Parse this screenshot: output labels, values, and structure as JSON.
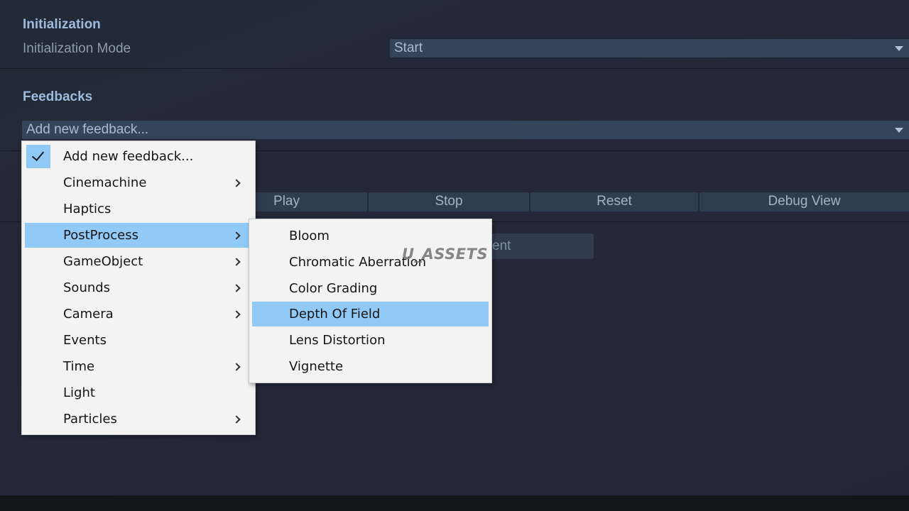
{
  "initialization": {
    "title": "Initialization",
    "mode_label": "Initialization Mode",
    "mode_value": "Start"
  },
  "feedbacks": {
    "title": "Feedbacks",
    "add_dropdown_value": "Add new feedback..."
  },
  "toolbar": {
    "play_label": "Play",
    "stop_label": "Stop",
    "reset_label": "Reset",
    "debug_label": "Debug View"
  },
  "obscured_button_text": "ent",
  "menu": {
    "items": [
      {
        "label": "Add new feedback...",
        "checked": true,
        "submenu": false
      },
      {
        "label": "Cinemachine",
        "submenu": true
      },
      {
        "label": "Haptics",
        "submenu": false
      },
      {
        "label": "PostProcess",
        "submenu": true,
        "highlighted": true
      },
      {
        "label": "GameObject",
        "submenu": true
      },
      {
        "label": "Sounds",
        "submenu": true
      },
      {
        "label": "Camera",
        "submenu": true
      },
      {
        "label": "Events",
        "submenu": false
      },
      {
        "label": "Time",
        "submenu": true
      },
      {
        "label": "Light",
        "submenu": false
      },
      {
        "label": "Particles",
        "submenu": true
      }
    ]
  },
  "submenu": {
    "items": [
      {
        "label": "Bloom"
      },
      {
        "label": "Chromatic Aberration"
      },
      {
        "label": "Color Grading"
      },
      {
        "label": "Depth Of Field",
        "highlighted": true
      },
      {
        "label": "Lens Distortion"
      },
      {
        "label": "Vignette"
      }
    ]
  },
  "watermark": "U_ASSETS",
  "colors": {
    "background": "#232838",
    "dropdown_bg": "#34445a",
    "menu_bg": "#f3f3f3",
    "highlight": "#91c9f7",
    "section_title": "#9fbbdc"
  }
}
